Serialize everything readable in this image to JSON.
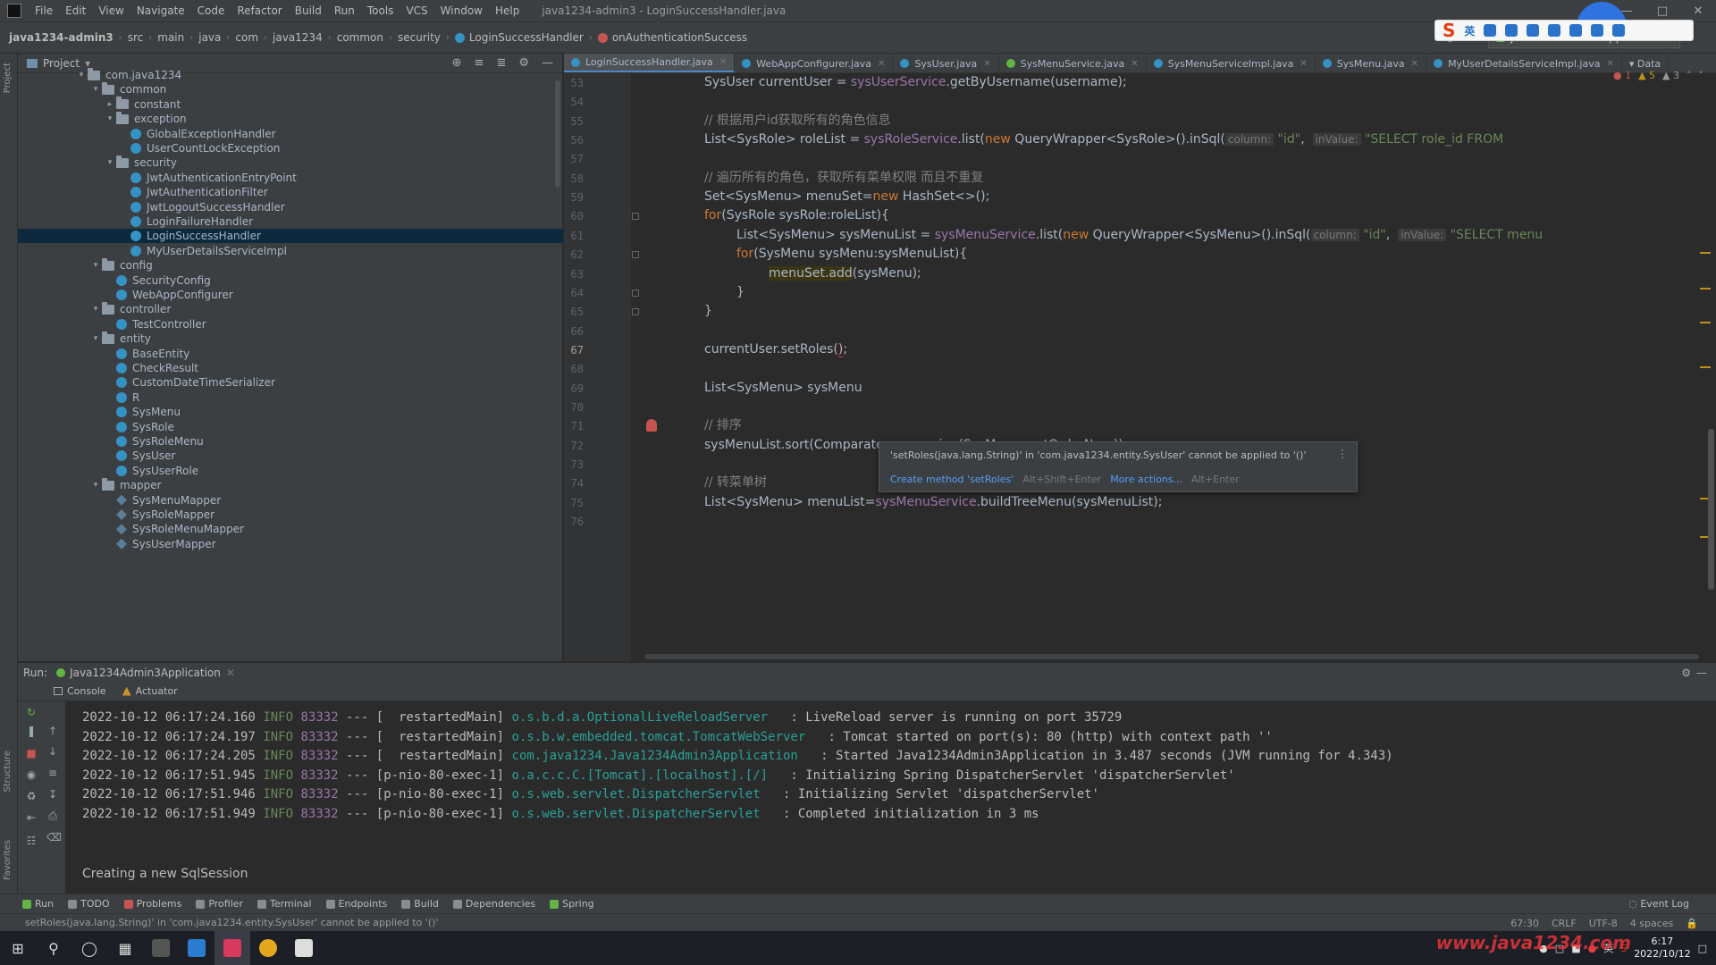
{
  "menubar": {
    "items": [
      "File",
      "Edit",
      "View",
      "Navigate",
      "Code",
      "Refactor",
      "Build",
      "Run",
      "Tools",
      "VCS",
      "Window",
      "Help"
    ],
    "window_title": "java1234-admin3 - LoginSuccessHandler.java"
  },
  "breadcrumbs": [
    "java1234-admin3",
    "src",
    "main",
    "java",
    "com",
    "java1234",
    "common",
    "security",
    "LoginSuccessHandler",
    "onAuthenticationSuccess"
  ],
  "run_config": "Java1234Admin3Application",
  "project_panel": {
    "title": "Project",
    "tree": [
      {
        "label": "com.java1234",
        "kind": "folder",
        "depth": 0,
        "expanded": true
      },
      {
        "label": "common",
        "kind": "folder",
        "depth": 1,
        "expanded": true
      },
      {
        "label": "constant",
        "kind": "folder",
        "depth": 2,
        "expanded": false
      },
      {
        "label": "exception",
        "kind": "folder",
        "depth": 2,
        "expanded": true
      },
      {
        "label": "GlobalExceptionHandler",
        "kind": "class",
        "depth": 3
      },
      {
        "label": "UserCountLockException",
        "kind": "class",
        "depth": 3
      },
      {
        "label": "security",
        "kind": "folder",
        "depth": 2,
        "expanded": true
      },
      {
        "label": "JwtAuthenticationEntryPoint",
        "kind": "class",
        "depth": 3
      },
      {
        "label": "JwtAuthenticationFilter",
        "kind": "class",
        "depth": 3
      },
      {
        "label": "JwtLogoutSuccessHandler",
        "kind": "class",
        "depth": 3
      },
      {
        "label": "LoginFailureHandler",
        "kind": "class",
        "depth": 3
      },
      {
        "label": "LoginSuccessHandler",
        "kind": "class",
        "depth": 3,
        "selected": true
      },
      {
        "label": "MyUserDetailsServiceImpl",
        "kind": "class",
        "depth": 3
      },
      {
        "label": "config",
        "kind": "folder",
        "depth": 1,
        "expanded": true
      },
      {
        "label": "SecurityConfig",
        "kind": "class",
        "depth": 2
      },
      {
        "label": "WebAppConfigurer",
        "kind": "class",
        "depth": 2
      },
      {
        "label": "controller",
        "kind": "folder",
        "depth": 1,
        "expanded": true
      },
      {
        "label": "TestController",
        "kind": "class",
        "depth": 2
      },
      {
        "label": "entity",
        "kind": "folder",
        "depth": 1,
        "expanded": true
      },
      {
        "label": "BaseEntity",
        "kind": "class",
        "depth": 2
      },
      {
        "label": "CheckResult",
        "kind": "class",
        "depth": 2
      },
      {
        "label": "CustomDateTimeSerializer",
        "kind": "class",
        "depth": 2
      },
      {
        "label": "R",
        "kind": "class",
        "depth": 2
      },
      {
        "label": "SysMenu",
        "kind": "class",
        "depth": 2
      },
      {
        "label": "SysRole",
        "kind": "class",
        "depth": 2
      },
      {
        "label": "SysRoleMenu",
        "kind": "class",
        "depth": 2
      },
      {
        "label": "SysUser",
        "kind": "class",
        "depth": 2
      },
      {
        "label": "SysUserRole",
        "kind": "class",
        "depth": 2
      },
      {
        "label": "mapper",
        "kind": "folder",
        "depth": 1,
        "expanded": true
      },
      {
        "label": "SysMenuMapper",
        "kind": "mapper",
        "depth": 2
      },
      {
        "label": "SysRoleMapper",
        "kind": "mapper",
        "depth": 2
      },
      {
        "label": "SysRoleMenuMapper",
        "kind": "mapper",
        "depth": 2
      },
      {
        "label": "SysUserMapper",
        "kind": "mapper",
        "depth": 2
      }
    ]
  },
  "editor": {
    "tabs": [
      {
        "label": "LoginSuccessHandler.java",
        "active": true,
        "color": "#3592c4"
      },
      {
        "label": "WebAppConfigurer.java",
        "active": false,
        "color": "#3592c4"
      },
      {
        "label": "SysUser.java",
        "active": false,
        "color": "#3592c4"
      },
      {
        "label": "SysMenuService.java",
        "active": false,
        "color": "#62b543"
      },
      {
        "label": "SysMenuServiceImpl.java",
        "active": false,
        "color": "#3592c4"
      },
      {
        "label": "SysMenu.java",
        "active": false,
        "color": "#3592c4"
      },
      {
        "label": "MyUserDetailsServiceImpl.java",
        "active": false,
        "color": "#3592c4"
      }
    ],
    "tabs_overflow": "Data",
    "inspections": {
      "errors": "1",
      "warnings": "5",
      "weak": "3"
    },
    "line_numbers": [
      "53",
      "54",
      "55",
      "56",
      "57",
      "58",
      "59",
      "60",
      "61",
      "62",
      "63",
      "64",
      "65",
      "66",
      "67",
      "68",
      "69",
      "70",
      "71",
      "72",
      "73",
      "74",
      "75",
      "76"
    ],
    "code": {
      "l53a": "SysUser currentUser = ",
      "l53b": "sysUserService",
      "l53c": ".getByUsername(username);",
      "l55": "// 根据用户id获取所有的角色信息",
      "l56a": "List<SysRole> roleList = ",
      "l56b": "sysRoleService",
      "l56c": ".list(",
      "l56d": "new ",
      "l56e": "QueryWrapper<SysRole>().inSql(",
      "l56f": "column:",
      "l56g": " \"id\"",
      "l56h": ",  ",
      "l56i": "inValue:",
      "l56j": " \"SELECT role_id FROM",
      "l58": "// 遍历所有的角色，获取所有菜单权限 而且不重复",
      "l59a": "Set<SysMenu> menuSet=",
      "l59b": "new ",
      "l59c": "HashSet<>();",
      "l60a": "for",
      "l60b": "(SysRole sysRole:roleList){",
      "l61a": "List<SysMenu> sysMenuList = ",
      "l61b": "sysMenuService",
      "l61c": ".list(",
      "l61d": "new ",
      "l61e": "QueryWrapper<SysMenu>().inSql(",
      "l61f": "column:",
      "l61g": " \"id\"",
      "l61h": ",  ",
      "l61i": "inValue:",
      "l61j": " \"SELECT menu",
      "l62a": "for",
      "l62b": "(SysMenu sysMenu:sysMenuList){",
      "l63a": "menuSet.add",
      "l63b": "(sysMenu);",
      "l64": "}",
      "l65": "}",
      "l67a": "currentUser.setRoles(",
      "l67b": ")",
      "l67c": ";",
      "l69": "List<SysMenu> sysMenu",
      "l71": "// 排序",
      "l72": "sysMenuList.sort(Comparator.comparing(SysMenu::getOrderNum));",
      "l74": "// 转菜单树",
      "l75a": "List<SysMenu> menuList=",
      "l75b": "sysMenuService",
      "l75c": ".buildTreeMenu(sysMenuList);"
    },
    "error_popup": {
      "message": "'setRoles(java.lang.String)' in 'com.java1234.entity.SysUser' cannot be applied to '()'",
      "action1": "Create method 'setRoles'",
      "shortcut1": "Alt+Shift+Enter",
      "action2": "More actions...",
      "shortcut2": "Alt+Enter"
    }
  },
  "run_panel": {
    "label": "Run:",
    "config_tab": "Java1234Admin3Application",
    "tabs": [
      "Console",
      "Actuator"
    ],
    "log": [
      {
        "ts": "2022-10-12 06:17:24.160",
        "level": "INFO",
        "pid": "83332",
        "thread": "[  restartedMain]",
        "logger": "o.s.b.d.a.OptionalLiveReloadServer",
        "msg": ": LiveReload server is running on port 35729"
      },
      {
        "ts": "2022-10-12 06:17:24.197",
        "level": "INFO",
        "pid": "83332",
        "thread": "[  restartedMain]",
        "logger": "o.s.b.w.embedded.tomcat.TomcatWebServer",
        "msg": ": Tomcat started on port(s): 80 (http) with context path ''"
      },
      {
        "ts": "2022-10-12 06:17:24.205",
        "level": "INFO",
        "pid": "83332",
        "thread": "[  restartedMain]",
        "logger": "com.java1234.Java1234Admin3Application",
        "msg": ": Started Java1234Admin3Application in 3.487 seconds (JVM running for 4.343)"
      },
      {
        "ts": "2022-10-12 06:17:51.945",
        "level": "INFO",
        "pid": "83332",
        "thread": "[p-nio-80-exec-1]",
        "logger": "o.a.c.c.C.[Tomcat].[localhost].[/]",
        "msg": ": Initializing Spring DispatcherServlet 'dispatcherServlet'"
      },
      {
        "ts": "2022-10-12 06:17:51.946",
        "level": "INFO",
        "pid": "83332",
        "thread": "[p-nio-80-exec-1]",
        "logger": "o.s.web.servlet.DispatcherServlet",
        "msg": ": Initializing Servlet 'dispatcherServlet'"
      },
      {
        "ts": "2022-10-12 06:17:51.949",
        "level": "INFO",
        "pid": "83332",
        "thread": "[p-nio-80-exec-1]",
        "logger": "o.s.web.servlet.DispatcherServlet",
        "msg": ": Completed initialization in 3 ms"
      }
    ],
    "last_line": "Creating a new SqlSession"
  },
  "bottom_tools": [
    "Run",
    "TODO",
    "Problems",
    "Profiler",
    "Terminal",
    "Endpoints",
    "Build",
    "Dependencies",
    "Spring"
  ],
  "event_log": "Event Log",
  "status": {
    "message": "setRoles(java.lang.String)' in 'com.java1234.entity.SysUser' cannot be applied to '()'",
    "position": "67:30",
    "line_sep": "CRLF",
    "encoding": "UTF-8",
    "indent": "4 spaces"
  },
  "taskbar": {
    "time": "6:17",
    "date": "2022/10/12",
    "watermark": "www.java1234.com"
  }
}
